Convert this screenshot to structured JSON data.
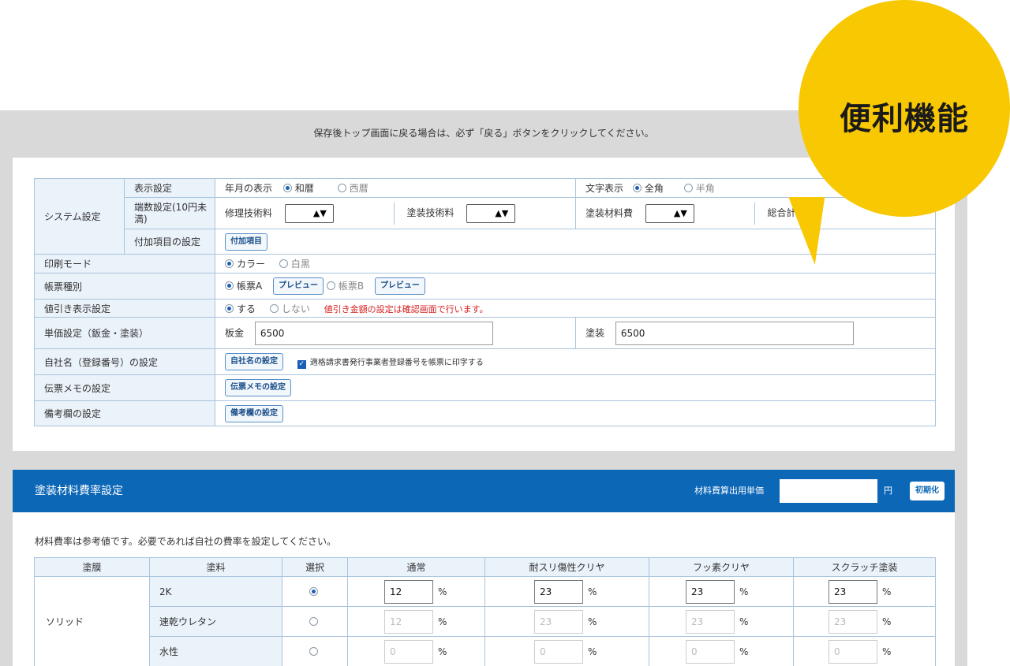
{
  "notice": "保存後トップ画面に戻る場合は、必ず「戻る」ボタンをクリックしてください。",
  "badge": "便利機能",
  "system": {
    "header": "システム設定",
    "display_label": "表示設定",
    "year_label": "年月の表示",
    "year_opt1": "和暦",
    "year_opt2": "西暦",
    "char_label": "文字表示",
    "char_opt1": "全角",
    "char_opt2": "半角",
    "rounding_label": "端数設定(10円未満)",
    "repair_label": "修理技術料",
    "paint_tech_label": "塗装技術料",
    "paint_mat_label": "塗装材料費",
    "total_label": "総合計",
    "select_arrow": "▲▼",
    "extra_label": "付加項目の設定",
    "extra_button": "付加項目"
  },
  "print_mode": {
    "label": "印刷モード",
    "opt1": "カラー",
    "opt2": "白黒"
  },
  "form_type": {
    "label": "帳票種別",
    "opt1": "帳票A",
    "preview": "プレビュー",
    "opt2": "帳票B"
  },
  "discount": {
    "label": "値引き表示設定",
    "opt1": "する",
    "opt2": "しない",
    "note": "値引き金額の設定は確認画面で行います。"
  },
  "unit_price": {
    "label": "単価設定（鈑金・塗装）",
    "sheet_label": "板金",
    "sheet_value": "6500",
    "paint_label": "塗装",
    "paint_value": "6500"
  },
  "company": {
    "label": "自社名（登録番号）の設定",
    "button": "自社名の設定",
    "checkbox_label": "適格請求書発行事業者登録番号を帳票に印字する"
  },
  "memo": {
    "label": "伝票メモの設定",
    "button": "伝票メモの設定"
  },
  "remarks": {
    "label": "備考欄の設定",
    "button": "備考欄の設定"
  },
  "material": {
    "title": "塗装材料費率設定",
    "unit_label": "材料費算出用単価",
    "yen": "円",
    "reset": "初期化",
    "note": "材料費率は参考値です。必要であれば自社の費率を設定してください。",
    "headers": [
      "塗膜",
      "塗料",
      "選択",
      "通常",
      "耐スリ傷性クリヤ",
      "フッ素クリヤ",
      "スクラッチ塗装"
    ],
    "type": "ソリッド",
    "pct": "%",
    "rows": [
      {
        "paint": "2K",
        "selected": true,
        "v1": "12",
        "v2": "23",
        "v3": "23",
        "v4": "23"
      },
      {
        "paint": "速乾ウレタン",
        "selected": false,
        "v1": "12",
        "v2": "23",
        "v3": "23",
        "v4": "23"
      },
      {
        "paint": "水性",
        "selected": false,
        "v1": "0",
        "v2": "0",
        "v3": "0",
        "v4": "0"
      }
    ]
  }
}
